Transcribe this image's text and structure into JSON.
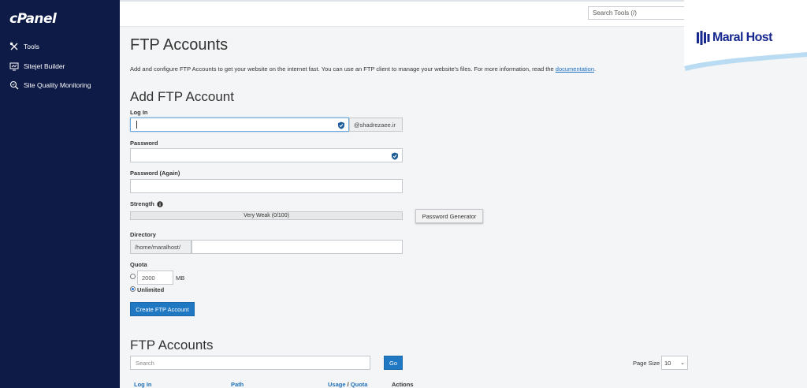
{
  "sidebar": {
    "logo": "cPanel",
    "items": [
      {
        "label": "Tools",
        "icon": "tools-icon"
      },
      {
        "label": "Sitejet Builder",
        "icon": "sitejet-icon"
      },
      {
        "label": "Site Quality Monitoring",
        "icon": "site-quality-icon"
      }
    ]
  },
  "topbar": {
    "search_placeholder": "Search Tools (/)"
  },
  "brand": {
    "name": "Maral Host"
  },
  "page": {
    "title": "FTP Accounts",
    "intro_text": "Add and configure FTP Accounts to get your website on the internet fast. You can use an FTP client to manage your website's files. For more information, read the ",
    "intro_link": "documentation",
    "intro_end": "."
  },
  "form": {
    "heading": "Add FTP Account",
    "login_label": "Log In",
    "login_value": "",
    "domain_suffix": "@shadrezaee.ir",
    "password_label": "Password",
    "password_again_label": "Password (Again)",
    "strength_label": "Strength",
    "strength_text": "Very Weak (0/100)",
    "strength_value": 0,
    "password_generator_label": "Password Generator",
    "directory_label": "Directory",
    "directory_prefix": "/home/maralhost/",
    "directory_value": "",
    "quota_label": "Quota",
    "quota_value": "2000",
    "quota_unit": "MB",
    "unlimited_label": "Unlimited",
    "quota_mode": "unlimited",
    "create_button": "Create FTP Account"
  },
  "accounts": {
    "heading": "FTP Accounts",
    "search_placeholder": "Search",
    "go_button": "Go",
    "page_size_label": "Page Size",
    "page_size_value": "10",
    "columns": {
      "login": "Log In",
      "path": "Path",
      "usage": "Usage",
      "separator": " / ",
      "quota": "Quota",
      "actions": "Actions"
    }
  },
  "colors": {
    "sidebar": "#0d1b46",
    "accent": "#1f78c1",
    "link": "#1a6fc0"
  }
}
